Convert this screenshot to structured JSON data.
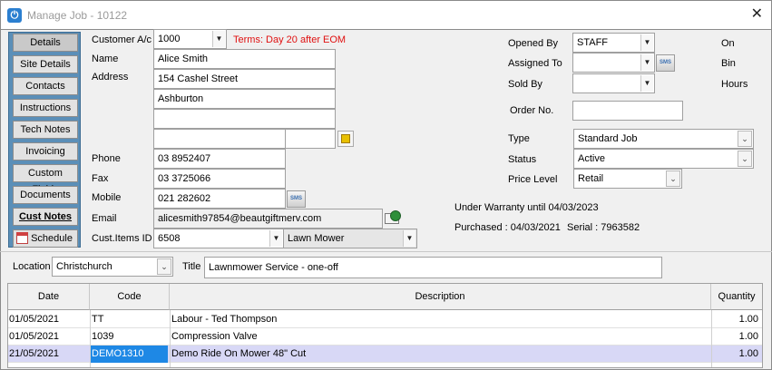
{
  "window": {
    "title": "Manage Job - 10122",
    "close_glyph": "✕"
  },
  "sidebar": {
    "items": [
      {
        "label": "Details"
      },
      {
        "label": "Site Details"
      },
      {
        "label": "Contacts"
      },
      {
        "label": "Instructions"
      },
      {
        "label": "Tech Notes"
      },
      {
        "label": "Invoicing"
      },
      {
        "label": "Custom Fields"
      },
      {
        "label": "Documents"
      },
      {
        "label": "Cust Notes"
      },
      {
        "label": "Schedule"
      }
    ]
  },
  "customer": {
    "account_label": "Customer A/c",
    "account_value": "1000",
    "terms": "Terms: Day 20 after EOM",
    "name_label": "Name",
    "name_value": "Alice Smith",
    "address_label": "Address",
    "address_line1": "154 Cashel Street",
    "address_line2": "Ashburton",
    "address_line3": "",
    "address_line4": "",
    "address_postcode": "",
    "phone_label": "Phone",
    "phone_value": "03 8952407",
    "fax_label": "Fax",
    "fax_value": "03 3725066",
    "mobile_label": "Mobile",
    "mobile_value": "021 282602",
    "email_label": "Email",
    "email_value": "alicesmith97854@beautgiftmerv.com",
    "items_label": "Cust.Items ID",
    "items_id": "6508",
    "items_desc": "Lawn Mower"
  },
  "job": {
    "opened_by_label": "Opened By",
    "opened_by_value": "STAFF",
    "assigned_to_label": "Assigned To",
    "assigned_to_value": "",
    "sold_by_label": "Sold By",
    "sold_by_value": "",
    "order_no_label": "Order No.",
    "order_no_value": "",
    "on_label": "On",
    "bin_label": "Bin",
    "hours_label": "Hours",
    "type_label": "Type",
    "type_value": "Standard Job",
    "status_label": "Status",
    "status_value": "Active",
    "price_level_label": "Price Level",
    "price_level_value": "Retail",
    "warranty": "Under Warranty until 04/03/2023",
    "purchased": "Purchased : 04/03/2021",
    "serial": "Serial : 7963582"
  },
  "location": {
    "label": "Location",
    "value": "Christchurch"
  },
  "title_field": {
    "label": "Title",
    "value": "Lawnmower Service - one-off"
  },
  "sms_label": "SMS",
  "table": {
    "columns": [
      "Date",
      "Code",
      "Description",
      "Quantity"
    ],
    "rows": [
      {
        "date": "01/05/2021",
        "code": "TT",
        "description": "Labour - Ted Thompson",
        "quantity": "1.00"
      },
      {
        "date": "01/05/2021",
        "code": "1039",
        "description": "Compression Valve",
        "quantity": "1.00"
      },
      {
        "date": "21/05/2021",
        "code": "DEMO1310",
        "description": "Demo Ride On Mower 48\" Cut",
        "quantity": "1.00"
      }
    ]
  }
}
